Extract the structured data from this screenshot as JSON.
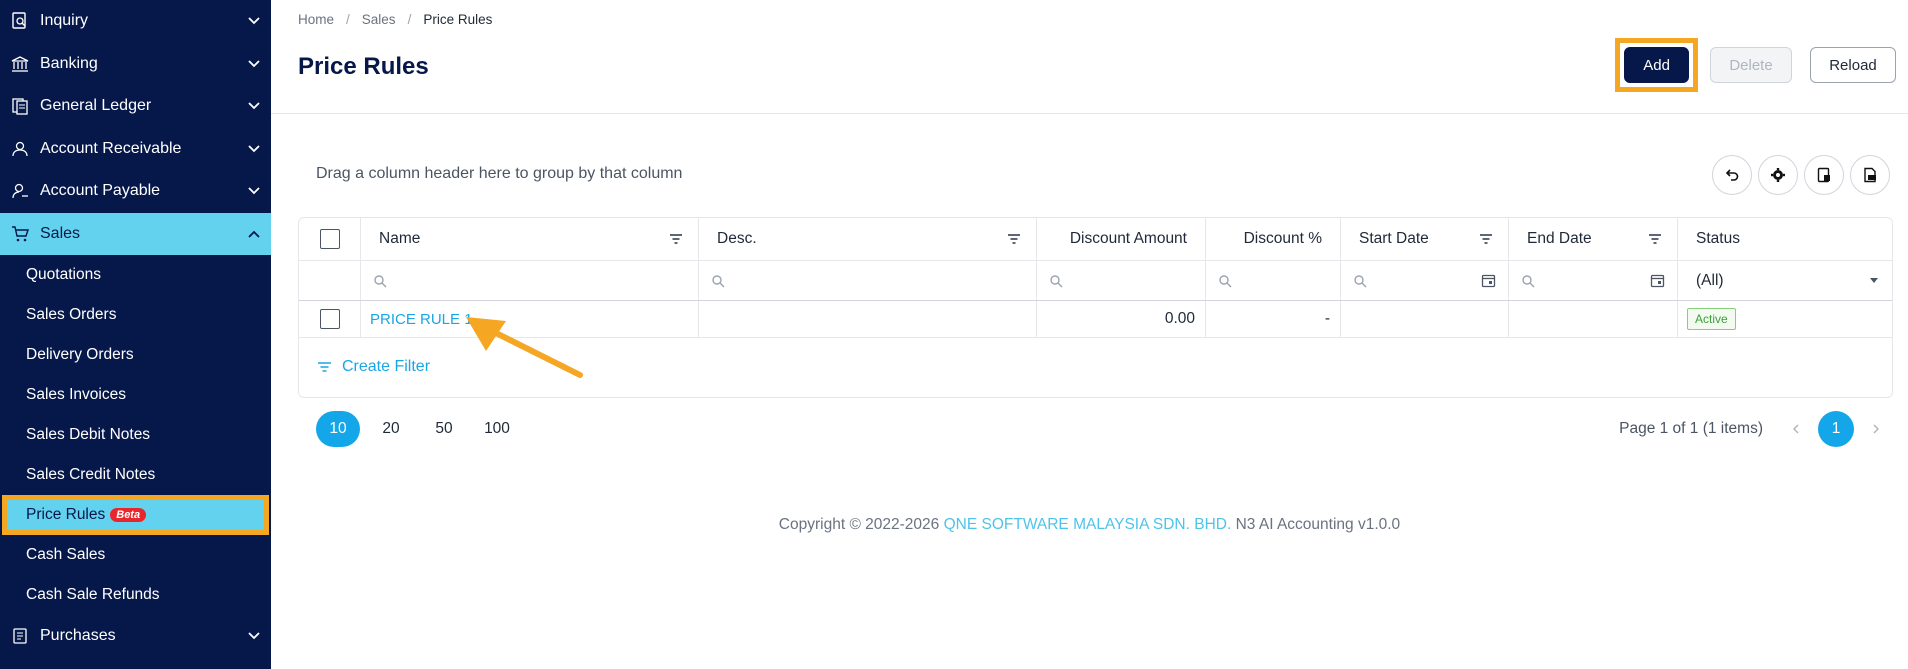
{
  "sidebar": {
    "groups_top": [
      {
        "label": "Inquiry",
        "icon": "inquiry-icon"
      },
      {
        "label": "Banking",
        "icon": "bank-icon"
      },
      {
        "label": "General Ledger",
        "icon": "ledger-icon"
      },
      {
        "label": "Account Receivable",
        "icon": "receivable-icon"
      },
      {
        "label": "Account Payable",
        "icon": "payable-icon"
      }
    ],
    "active_group": {
      "label": "Sales",
      "icon": "cart-icon"
    },
    "sales_items": [
      {
        "label": "Quotations"
      },
      {
        "label": "Sales Orders"
      },
      {
        "label": "Delivery Orders"
      },
      {
        "label": "Sales Invoices"
      },
      {
        "label": "Sales Debit Notes"
      },
      {
        "label": "Sales Credit Notes"
      },
      {
        "label": "Price Rules",
        "badge": "Beta"
      },
      {
        "label": "Cash Sales"
      },
      {
        "label": "Cash Sale Refunds"
      }
    ],
    "groups_bottom": [
      {
        "label": "Purchases",
        "icon": "purchases-icon"
      }
    ]
  },
  "breadcrumb": {
    "home": "Home",
    "sales": "Sales",
    "current": "Price Rules"
  },
  "page_title": "Price Rules",
  "actions": {
    "add": "Add",
    "delete": "Delete",
    "reload": "Reload"
  },
  "group_hint": "Drag a column header here to group by that column",
  "grid": {
    "columns": {
      "name": "Name",
      "desc": "Desc.",
      "discount_amount": "Discount Amount",
      "discount_percent": "Discount %",
      "start_date": "Start Date",
      "end_date": "End Date",
      "status": "Status"
    },
    "status_filter": "(All)",
    "row": {
      "name": "PRICE RULE 1",
      "desc": "",
      "discount_amount": "0.00",
      "discount_percent": "-",
      "start_date": "",
      "end_date": "",
      "status": "Active"
    },
    "create_filter": "Create Filter"
  },
  "pager": {
    "sizes": [
      "10",
      "20",
      "50",
      "100"
    ],
    "selected_size": "10",
    "info": "Page 1 of 1 (1 items)",
    "current_page": "1"
  },
  "footer": {
    "copyright": "Copyright © 2022-2026",
    "company": "QNE SOFTWARE MALAYSIA SDN. BHD.",
    "product": "N3 AI Accounting v1.0.0"
  },
  "colors": {
    "sidebar_bg": "#06184a",
    "active_bg": "#62d2ef",
    "annotation": "#f5a623",
    "link": "#1aa6e6"
  }
}
